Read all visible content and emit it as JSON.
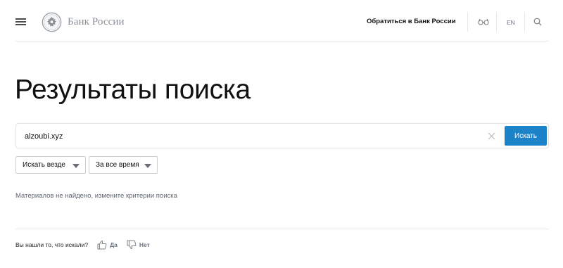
{
  "header": {
    "logo_text": "Банк России",
    "contact_label": "Обратиться в Банк России",
    "lang_label": "EN"
  },
  "page": {
    "title": "Результаты поиска"
  },
  "search": {
    "value": "alzoubi.xyz",
    "button_label": "Искать"
  },
  "filters": {
    "scope_label": "Искать везде",
    "period_label": "За все время"
  },
  "results": {
    "empty_message": "Материалов не найдено, измените критерии поиска"
  },
  "feedback": {
    "question": "Вы нашли то, что искали?",
    "yes_label": "Да",
    "no_label": "Нет"
  },
  "colors": {
    "accent": "#1c83c9",
    "logo_gray": "#8a8f96"
  },
  "icons": [
    "menu-icon",
    "bank-emblem-icon",
    "glasses-icon",
    "search-icon",
    "clear-icon",
    "chevron-down-icon",
    "thumbs-up-icon",
    "thumbs-down-icon"
  ]
}
